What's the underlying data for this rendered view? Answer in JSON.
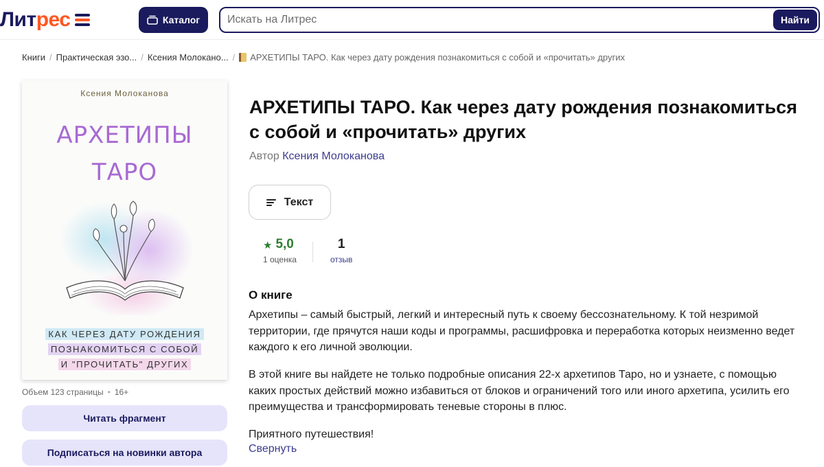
{
  "header": {
    "logo_part1": "Лит",
    "logo_part2": "рес",
    "catalog_label": "Каталог",
    "search_placeholder": "Искать на Литрес",
    "search_button": "Найти",
    "colors": {
      "brand": "#1a1a5e",
      "accent": "#ff5722"
    }
  },
  "breadcrumbs": {
    "items": [
      "Книги",
      "Практическая эзо...",
      "Ксения Молокано..."
    ],
    "current": "АРХЕТИПЫ ТАРО. Как через дату рождения познакомиться с собой и «прочитать» других"
  },
  "cover": {
    "author": "Ксения Молоканова",
    "title_line1": "АРХЕТИПЫ",
    "title_line2": "ТАРО",
    "subtitle_line1": "КАК ЧЕРЕЗ ДАТУ РОЖДЕНИЯ",
    "subtitle_line2": "ПОЗНАКОМИТЬСЯ С СОБОЙ",
    "subtitle_line3": "И \"ПРОЧИТАТЬ\" ДРУГИХ"
  },
  "meta": {
    "volume": "Объем 123 страницы",
    "age": "16+"
  },
  "side_buttons": {
    "read_fragment": "Читать фрагмент",
    "subscribe": "Подписаться на новинки автора"
  },
  "book": {
    "title": "АРХЕТИПЫ ТАРО. Как через дату рождения познакомиться с собой и «прочитать» других",
    "author_prefix": "Автор",
    "author_name": "Ксения Молоканова",
    "format_label": "Текст"
  },
  "stats": {
    "rating_value": "5,0",
    "rating_label": "1 оценка",
    "reviews_value": "1",
    "reviews_label": "отзыв",
    "rating_color": "#2e7d32"
  },
  "about": {
    "heading": "О книге",
    "paragraph1": "Архетипы – самый быстрый, легкий и интересный путь к своему бессознательному. К той незримой территории, где прячутся наши коды и программы, расшифровка и переработка которых неизменно ведет каждого к его личной эволюции.",
    "paragraph2": "В этой книге вы найдете не только подробные описания 22-х архетипов Таро, но и узнаете, с помощью каких простых действий можно избавиться от блоков и ограничений того или иного архетипа, усилить его преимущества и трансформировать теневые стороны в плюс.",
    "paragraph3": "Приятного путешествия!",
    "collapse_label": "Свернуть"
  }
}
